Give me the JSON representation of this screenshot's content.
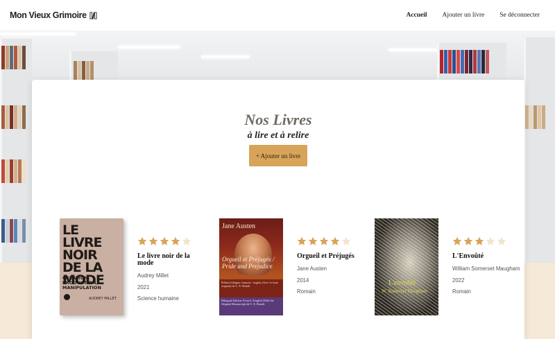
{
  "brand": {
    "name": "Mon Vieux Grimoire",
    "icon": "book-logo-icon"
  },
  "nav": [
    {
      "label": "Accueil",
      "active": true
    },
    {
      "label": "Ajouter un livre",
      "active": false
    },
    {
      "label": "Se déconnecter",
      "active": false
    }
  ],
  "page": {
    "title": "Nos Livres",
    "subtitle": "à lire et à relire",
    "add_button": "+ Ajouter un livre"
  },
  "colors": {
    "accent": "#d7a459",
    "star_on": "#d7a459",
    "star_off": "#f1e3cd"
  },
  "books": [
    {
      "title": "Le livre noir de la mode",
      "author": "Audrey Millet",
      "year": "2021",
      "genre": "Science humaine",
      "rating": 4,
      "cover": {
        "title": "LE LIVRE NOIR DE LA MODE",
        "subtitle": "CRÉATION, PRODUCTION, MANIPULATION",
        "author": "AUDREY MILLET"
      }
    },
    {
      "title": "Orgueil et Préjugés",
      "author": "Jane Austen",
      "year": "2014",
      "genre": "Romain",
      "rating": 4,
      "cover": {
        "author": "Jane Austen",
        "title": "Orgueil et Préjugés / Pride and Prejudice",
        "edition_fr": "Édition bilingue: français / anglais (Avec le texte original) de C. E. Brandt",
        "edition_en": "Bilingual Edition: French / English (With the Original Manuscript) de C. E. Brandt"
      }
    },
    {
      "title": "L'Envoûté",
      "author": "William Somerset Maugham",
      "year": "2022",
      "genre": "Romain",
      "rating": 3,
      "cover": {
        "title": "L'envoûté",
        "author": "W. Somerset Maugham"
      }
    }
  ]
}
